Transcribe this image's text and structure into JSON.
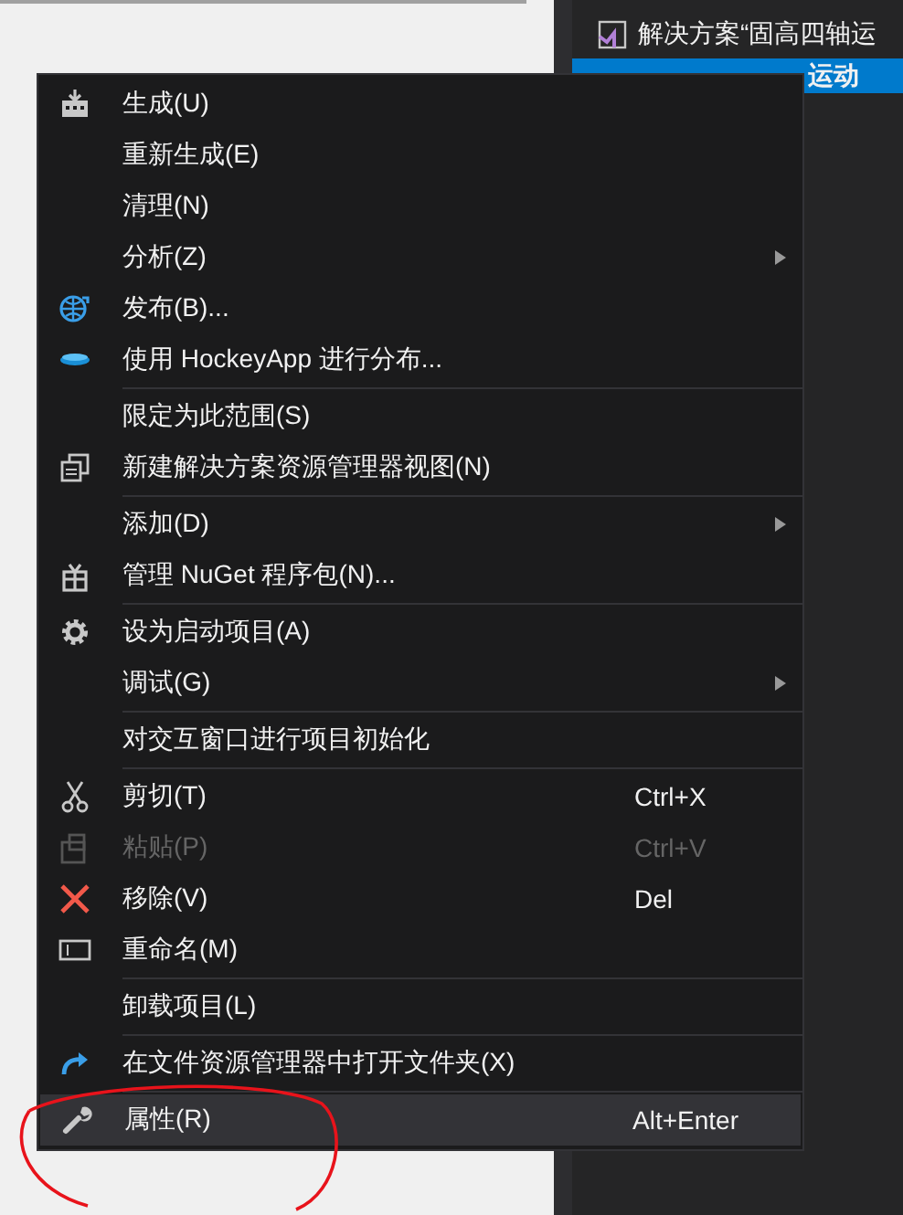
{
  "explorer": {
    "items": [
      {
        "kind": "solution",
        "label": "解决方案“固高四轴运",
        "selected": false
      },
      {
        "kind": "project",
        "label": "运动",
        "selected": true
      }
    ]
  },
  "context_menu": {
    "groups": [
      [
        {
          "label": "生成(U)",
          "kind": "build",
          "selected": false
        },
        {
          "label": "重新生成(E)",
          "selected": false
        },
        {
          "label": "清理(N)",
          "selected": false
        },
        {
          "label": "分析(Z)",
          "submenu": true,
          "selected": false
        },
        {
          "label": "发布(B)...",
          "kind": "publish",
          "selected": false
        },
        {
          "label": "使用 HockeyApp 进行分布...",
          "kind": "distribute",
          "selected": false
        }
      ],
      [
        {
          "label": "限定为此范围(S)",
          "selected": false
        },
        {
          "label": "新建解决方案资源管理器视图(N)",
          "kind": "view",
          "selected": false
        }
      ],
      [
        {
          "label": "添加(D)",
          "submenu": true,
          "selected": false
        },
        {
          "label": "管理 NuGet 程序包(N)...",
          "kind": "package",
          "selected": false
        }
      ],
      [
        {
          "label": "设为启动项目(A)",
          "kind": "settings",
          "selected": false
        },
        {
          "label": "调试(G)",
          "submenu": true,
          "selected": false
        }
      ],
      [
        {
          "label": "对交互窗口进行项目初始化",
          "selected": false
        }
      ],
      [
        {
          "label": "剪切(T)",
          "shortcut": "Ctrl+X",
          "kind": "cut",
          "selected": false
        },
        {
          "label": "粘贴(P)",
          "shortcut": "Ctrl+V",
          "kind": "paste",
          "disabled": true,
          "selected": false
        },
        {
          "label": "移除(V)",
          "shortcut": "Del",
          "kind": "remove",
          "selected": false
        },
        {
          "label": "重命名(M)",
          "kind": "rename",
          "selected": false
        }
      ],
      [
        {
          "label": "卸载项目(L)",
          "selected": false
        }
      ],
      [
        {
          "label": "在文件资源管理器中打开文件夹(X)",
          "kind": "open",
          "selected": false
        }
      ],
      [
        {
          "label": "属性(R)",
          "shortcut": "Alt+Enter",
          "kind": "properties",
          "selected": true
        }
      ]
    ]
  },
  "annotation": {
    "kind": "ellipse"
  }
}
